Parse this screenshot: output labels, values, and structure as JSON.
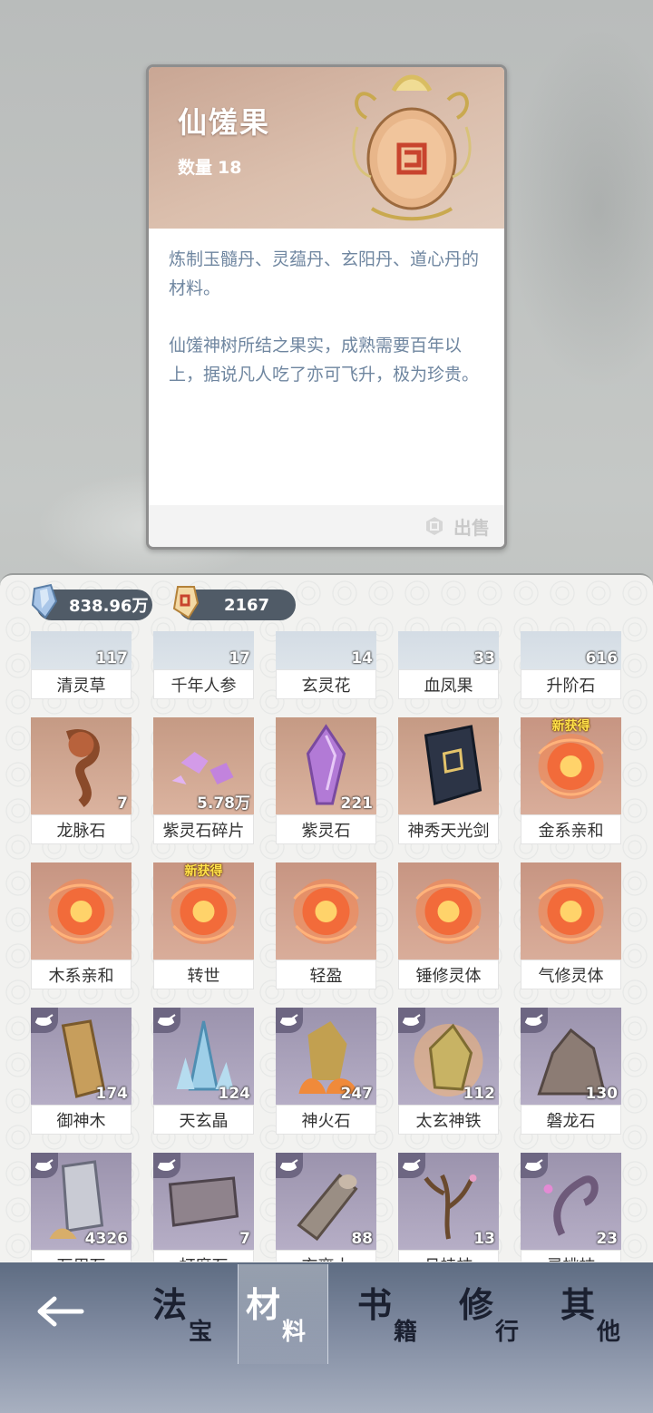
{
  "detail": {
    "name": "仙馐果",
    "count_label": "数量",
    "count_value": "18",
    "desc_1": "炼制玉髓丹、灵蕴丹、玄阳丹、道心丹的材料。",
    "desc_2": "仙馐神树所结之果实，成熟需要百年以上，据说凡人吃了亦可飞升，极为珍贵。",
    "sell_label": "出售"
  },
  "currency": {
    "spirit_stone": "838.96万",
    "gold_token": "2167"
  },
  "items": [
    [
      {
        "name": "清灵草",
        "qty": "117",
        "bg": "blue",
        "icon": "herb-icon"
      },
      {
        "name": "千年人参",
        "qty": "17",
        "bg": "blue",
        "icon": "ginseng-icon"
      },
      {
        "name": "玄灵花",
        "qty": "14",
        "bg": "blue",
        "icon": "flower-icon"
      },
      {
        "name": "血凤果",
        "qty": "33",
        "bg": "blue",
        "icon": "fruit-icon"
      },
      {
        "name": "升阶石",
        "qty": "616",
        "bg": "blue",
        "icon": "stone-icon"
      }
    ],
    [
      {
        "name": "龙脉石",
        "qty": "7",
        "bg": "orange",
        "icon": "dragon-vein-stone-icon"
      },
      {
        "name": "紫灵石碎片",
        "qty": "5.78万",
        "bg": "orange",
        "icon": "purple-shard-icon"
      },
      {
        "name": "紫灵石",
        "qty": "221",
        "bg": "orange",
        "icon": "purple-crystal-icon"
      },
      {
        "name": "神秀天光剑",
        "qty": "",
        "bg": "orange",
        "icon": "rune-stone-icon"
      },
      {
        "name": "金系亲和",
        "qty": "",
        "bg": "fire",
        "icon": "fire-orb-icon",
        "new": "新获得"
      }
    ],
    [
      {
        "name": "木系亲和",
        "qty": "",
        "bg": "fire",
        "icon": "fire-orb-icon"
      },
      {
        "name": "转世",
        "qty": "",
        "bg": "fire",
        "icon": "fire-orb-icon",
        "new": "新获得"
      },
      {
        "name": "轻盈",
        "qty": "",
        "bg": "fire",
        "icon": "fire-orb-icon"
      },
      {
        "name": "锤修灵体",
        "qty": "",
        "bg": "fire",
        "icon": "fire-orb-icon"
      },
      {
        "name": "气修灵体",
        "qty": "",
        "bg": "fire",
        "icon": "fire-orb-icon"
      }
    ],
    [
      {
        "name": "御神木",
        "qty": "174",
        "bg": "purple",
        "icon": "wood-icon"
      },
      {
        "name": "天玄晶",
        "qty": "124",
        "bg": "purple",
        "icon": "ice-crystal-icon"
      },
      {
        "name": "神火石",
        "qty": "247",
        "bg": "purple",
        "icon": "fire-stone-icon"
      },
      {
        "name": "太玄神铁",
        "qty": "112",
        "bg": "purple",
        "icon": "iron-ore-icon"
      },
      {
        "name": "磐龙石",
        "qty": "130",
        "bg": "purple",
        "icon": "dragon-rock-icon"
      }
    ],
    [
      {
        "name": "万用石",
        "qty": "4326",
        "bg": "purple",
        "icon": "universal-stone-icon"
      },
      {
        "name": "打磨石",
        "qty": "7",
        "bg": "purple",
        "icon": "whetstone-icon"
      },
      {
        "name": "玄离木",
        "qty": "88",
        "bg": "purple",
        "icon": "log-icon"
      },
      {
        "name": "月桂枝",
        "qty": "13",
        "bg": "purple",
        "icon": "laurel-branch-icon"
      },
      {
        "name": "灵桃枝",
        "qty": "23",
        "bg": "purple",
        "icon": "peach-branch-icon"
      }
    ]
  ],
  "nav": {
    "tab_fa_big": "法",
    "tab_fa_small": "宝",
    "tab_cai_big": "材",
    "tab_cai_small": "料",
    "tab_shu_big": "书",
    "tab_shu_small": "籍",
    "tab_xiu_big": "修",
    "tab_xiu_small": "行",
    "tab_qi_big": "其",
    "tab_qi_small": "他"
  }
}
